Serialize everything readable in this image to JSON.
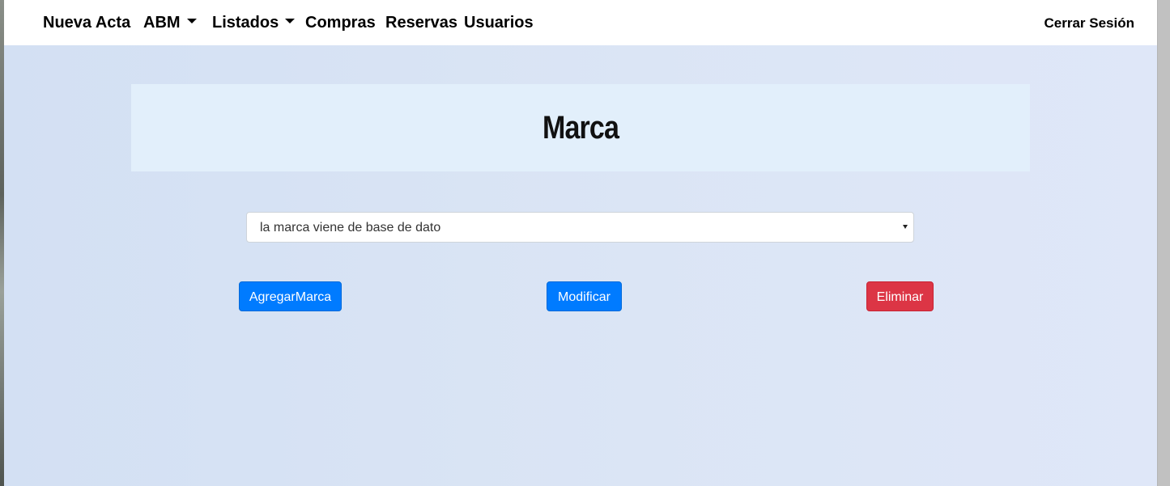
{
  "navbar": {
    "items": [
      {
        "label": "Nueva Acta",
        "has_dropdown": false
      },
      {
        "label": "ABM",
        "has_dropdown": true
      },
      {
        "label": "Listados",
        "has_dropdown": true
      },
      {
        "label": "Compras",
        "has_dropdown": false
      },
      {
        "label": "Reservas",
        "has_dropdown": false
      },
      {
        "label": "Usuarios",
        "has_dropdown": false
      }
    ],
    "logout_label": "Cerrar Sesión"
  },
  "main": {
    "title": "Marca",
    "marca_select": {
      "selected": "la marca viene de base de dato"
    },
    "buttons": {
      "add_label": "AgregarMarca",
      "modify_label": "Modificar",
      "delete_label": "Eliminar"
    }
  },
  "colors": {
    "primary": "#007bff",
    "danger": "#dc3545",
    "title_bg": "#e2effb",
    "page_bg": "#d9e4f5"
  },
  "icons": {
    "dropdown_caret": "chevron-down-icon",
    "select_arrow": "chevron-down-icon"
  }
}
